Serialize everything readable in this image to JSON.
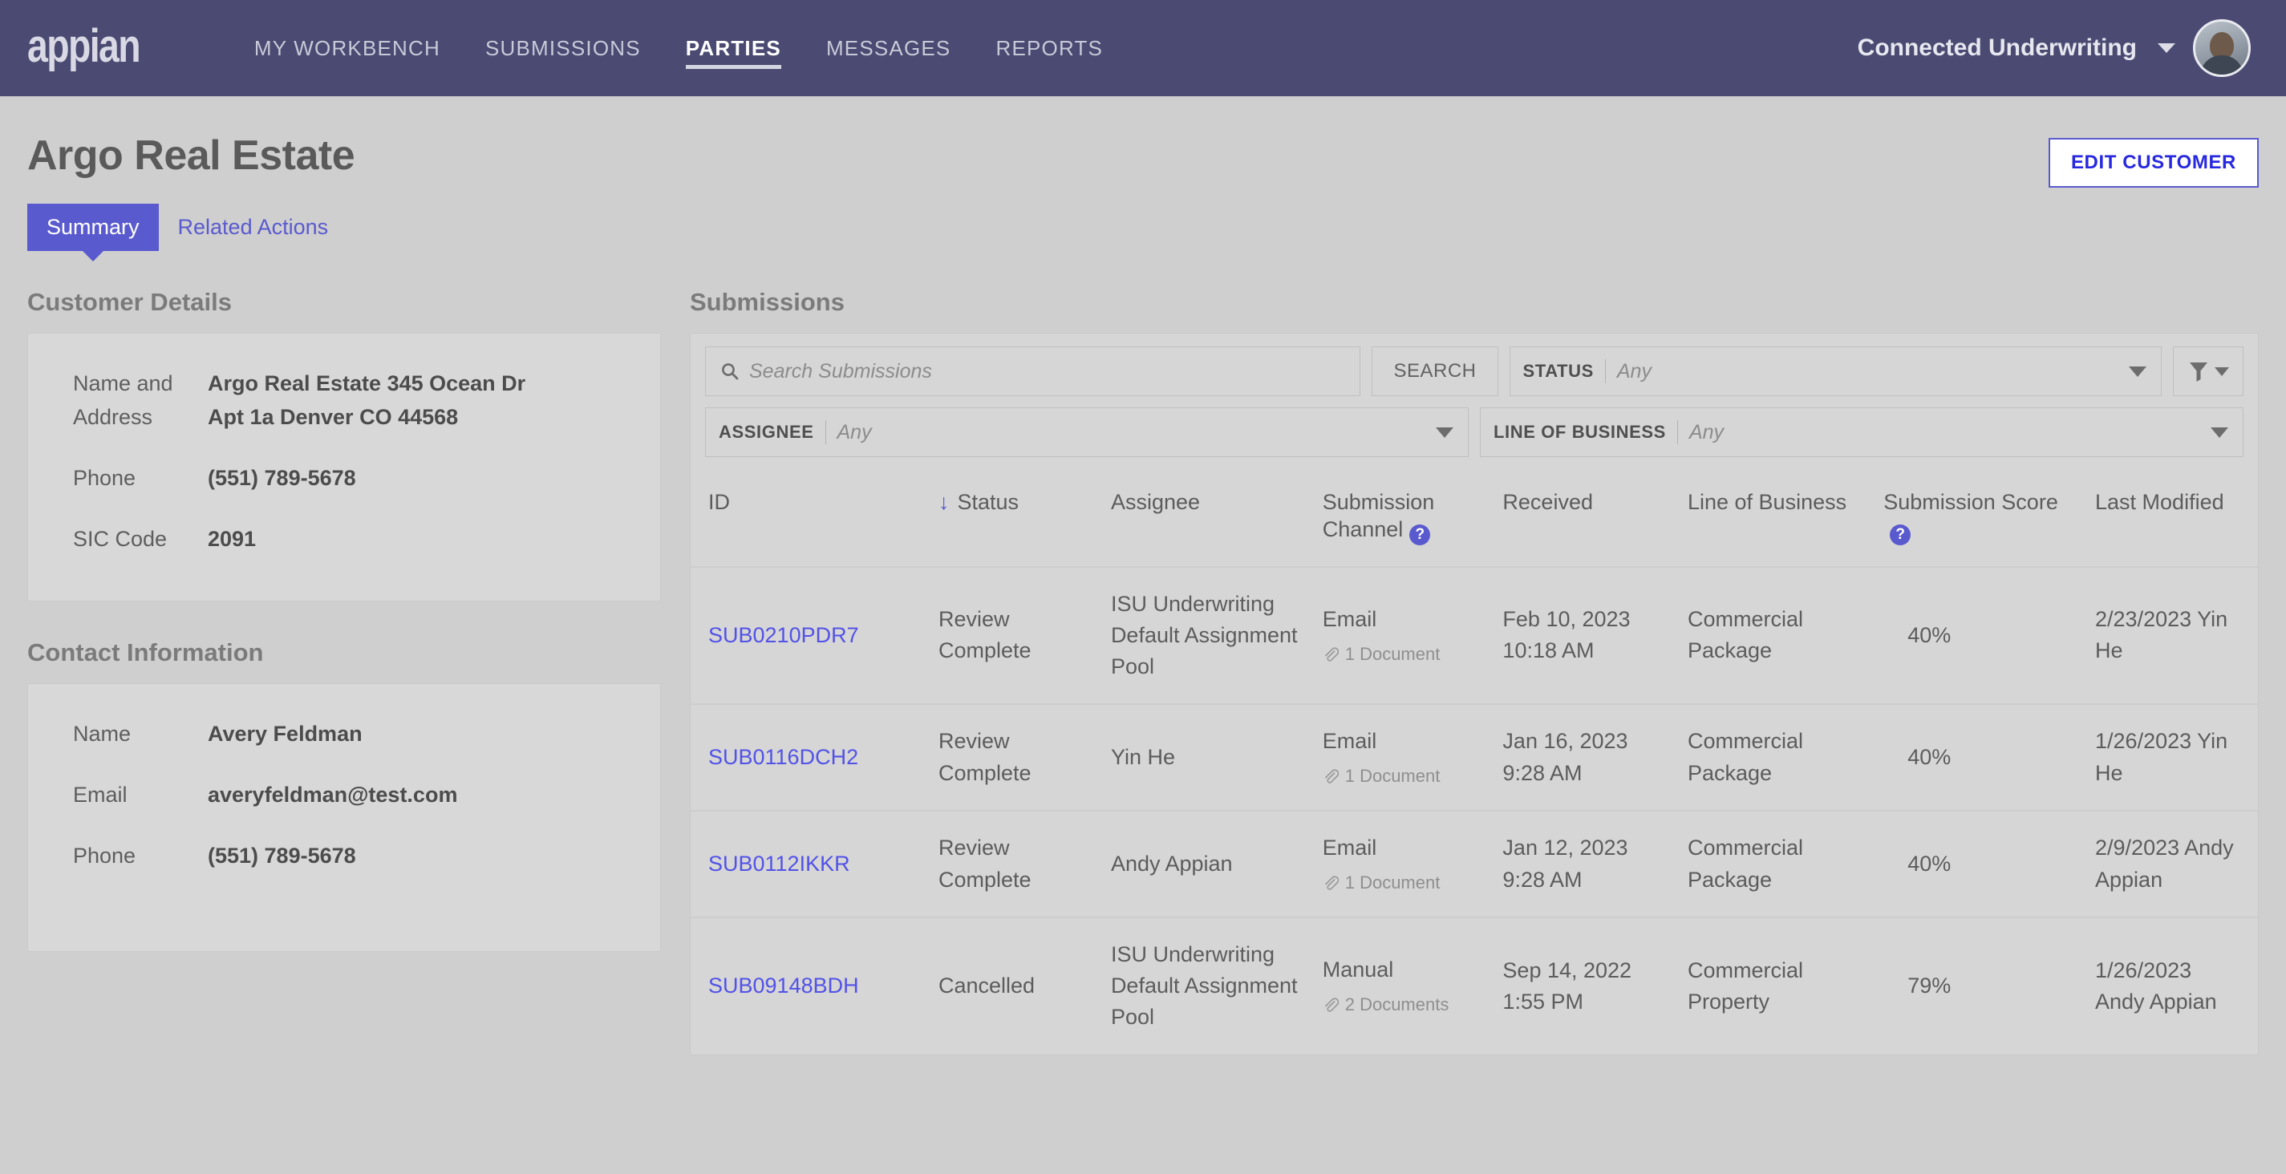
{
  "nav": {
    "logo": "appian",
    "links": [
      {
        "label": "MY WORKBENCH",
        "active": false
      },
      {
        "label": "SUBMISSIONS",
        "active": false
      },
      {
        "label": "PARTIES",
        "active": true
      },
      {
        "label": "MESSAGES",
        "active": false
      },
      {
        "label": "REPORTS",
        "active": false
      }
    ],
    "account": "Connected Underwriting",
    "account_caret_icon": "chevron-down-icon",
    "avatar_icon": "user-avatar"
  },
  "page": {
    "title": "Argo Real Estate",
    "edit_button": "EDIT CUSTOMER",
    "tabs": [
      {
        "label": "Summary",
        "active": true
      },
      {
        "label": "Related Actions",
        "active": false
      }
    ]
  },
  "customer_details": {
    "heading": "Customer Details",
    "rows": [
      {
        "label": "Name and Address",
        "value": "Argo Real Estate 345 Ocean Dr Apt 1a Denver CO 44568"
      },
      {
        "label": "Phone",
        "value": "(551) 789-5678"
      },
      {
        "label": "SIC Code",
        "value": "2091"
      }
    ]
  },
  "contact_information": {
    "heading": "Contact Information",
    "rows": [
      {
        "label": "Name",
        "value": "Avery Feldman"
      },
      {
        "label": "Email",
        "value": "averyfeldman@test.com"
      },
      {
        "label": "Phone",
        "value": "(551) 789-5678"
      }
    ]
  },
  "submissions": {
    "heading": "Submissions",
    "search": {
      "placeholder": "Search Submissions",
      "value": "",
      "icon": "search-icon",
      "button": "SEARCH"
    },
    "filter_icon_button": {
      "icon": "funnel-icon"
    },
    "dropdowns": [
      {
        "label": "STATUS",
        "value": "Any"
      },
      {
        "label": "ASSIGNEE",
        "value": "Any"
      },
      {
        "label": "LINE OF BUSINESS",
        "value": "Any"
      }
    ],
    "columns": [
      {
        "key": "id",
        "label": "ID"
      },
      {
        "key": "status",
        "label": "Status",
        "sorted": true,
        "sort_icon": "arrow-down-icon"
      },
      {
        "key": "assignee",
        "label": "Assignee"
      },
      {
        "key": "channel",
        "label": "Submission Channel",
        "help": true
      },
      {
        "key": "received",
        "label": "Received"
      },
      {
        "key": "lob",
        "label": "Line of Business"
      },
      {
        "key": "score",
        "label": "Submission Score",
        "help": true
      },
      {
        "key": "modified",
        "label": "Last Modified"
      }
    ],
    "rows": [
      {
        "id": "SUB0210PDR7",
        "status": "Review Complete",
        "assignee": "ISU Underwriting Default Assignment Pool",
        "channel": "Email",
        "documents": "1 Document",
        "received": "Feb 10, 2023 10:18 AM",
        "lob": "Commercial Package",
        "score": "40%",
        "modified": "2/23/2023 Yin He"
      },
      {
        "id": "SUB0116DCH2",
        "status": "Review Complete",
        "assignee": "Yin He",
        "channel": "Email",
        "documents": "1 Document",
        "received": "Jan 16, 2023 9:28 AM",
        "lob": "Commercial Package",
        "score": "40%",
        "modified": "1/26/2023 Yin He"
      },
      {
        "id": "SUB0112IKKR",
        "status": "Review Complete",
        "assignee": "Andy Appian",
        "channel": "Email",
        "documents": "1 Document",
        "received": "Jan 12, 2023 9:28 AM",
        "lob": "Commercial Package",
        "score": "40%",
        "modified": "2/9/2023 Andy Appian"
      },
      {
        "id": "SUB09148BDH",
        "status": "Cancelled",
        "assignee": "ISU Underwriting Default Assignment Pool",
        "channel": "Manual",
        "documents": "2 Documents",
        "received": "Sep 14, 2022 1:55 PM",
        "lob": "Commercial Property",
        "score": "79%",
        "modified": "1/26/2023 Andy Appian"
      }
    ]
  },
  "colors": {
    "nav_background": "#4a4a72",
    "accent_purple": "#5a5acf",
    "link_blue": "#5252e8",
    "page_background": "#cfcfcf",
    "card_background": "#d8d8d8"
  }
}
